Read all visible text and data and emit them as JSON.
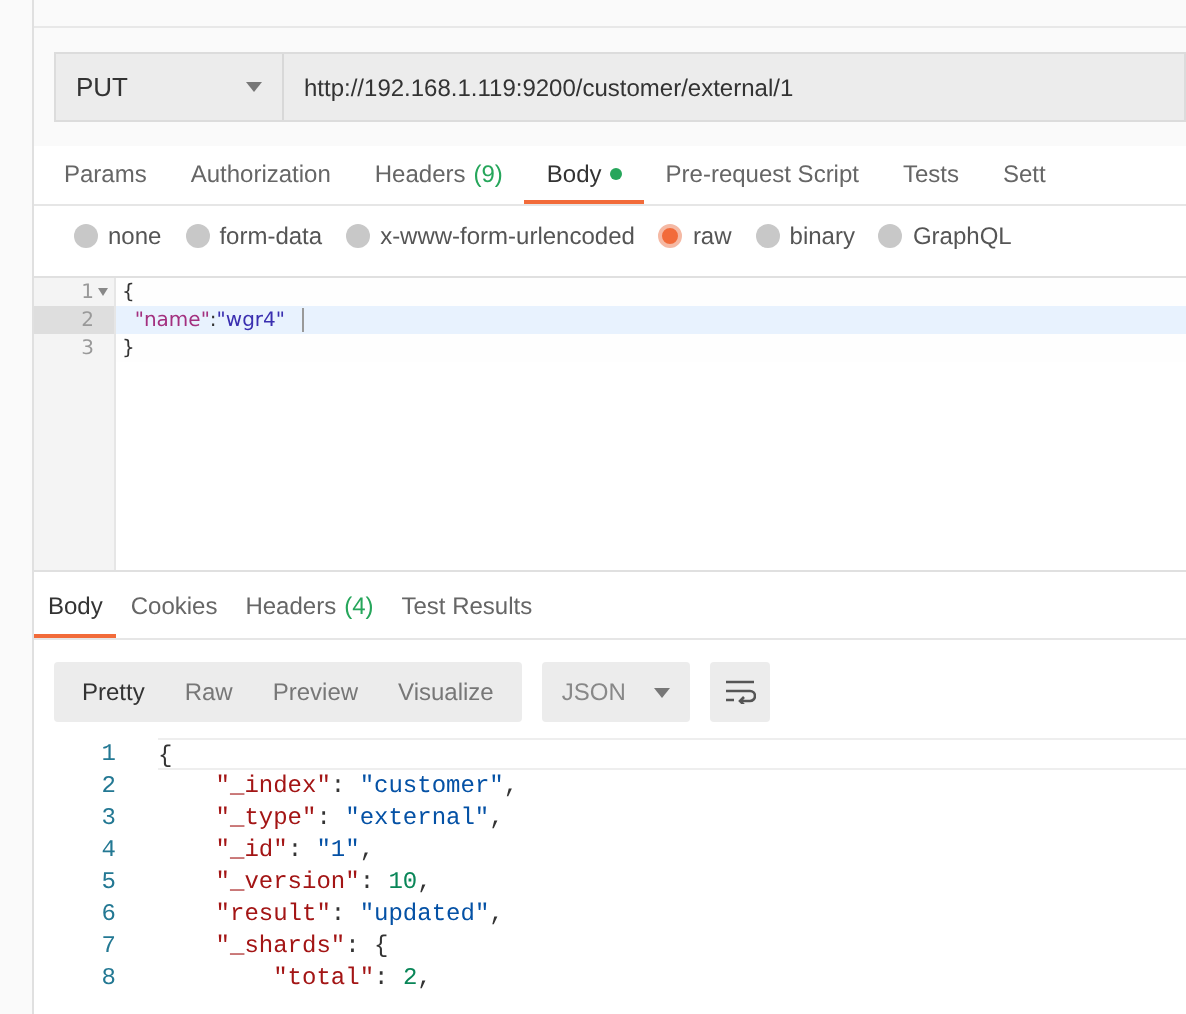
{
  "request": {
    "method": "PUT",
    "url": "http://192.168.1.119:9200/customer/external/1"
  },
  "request_tabs": [
    {
      "label": "Params",
      "selected": false
    },
    {
      "label": "Authorization",
      "selected": false
    },
    {
      "label": "Headers",
      "count": "(9)",
      "selected": false
    },
    {
      "label": "Body",
      "dot": true,
      "selected": true
    },
    {
      "label": "Pre-request Script",
      "selected": false
    },
    {
      "label": "Tests",
      "selected": false
    },
    {
      "label": "Sett",
      "selected": false
    }
  ],
  "body_types": [
    {
      "label": "none",
      "selected": false
    },
    {
      "label": "form-data",
      "selected": false
    },
    {
      "label": "x-www-form-urlencoded",
      "selected": false
    },
    {
      "label": "raw",
      "selected": true
    },
    {
      "label": "binary",
      "selected": false
    },
    {
      "label": "GraphQL",
      "selected": false
    }
  ],
  "request_editor": {
    "lines": [
      {
        "number": "1",
        "foldable": true,
        "active": false,
        "tokens": [
          {
            "kind": "punct",
            "text": "{"
          }
        ]
      },
      {
        "number": "2",
        "foldable": false,
        "active": true,
        "tokens": [
          {
            "kind": "key",
            "text": "  \"name\""
          },
          {
            "kind": "punct",
            "text": ":"
          },
          {
            "kind": "string",
            "text": "\"wgr4\""
          }
        ]
      },
      {
        "number": "3",
        "foldable": false,
        "active": false,
        "tokens": [
          {
            "kind": "punct",
            "text": "}"
          }
        ]
      }
    ]
  },
  "response_tabs": [
    {
      "label": "Body",
      "selected": true
    },
    {
      "label": "Cookies",
      "selected": false
    },
    {
      "label": "Headers",
      "count": "(4)",
      "selected": false
    },
    {
      "label": "Test Results",
      "selected": false
    }
  ],
  "view_modes": [
    {
      "label": "Pretty",
      "selected": true
    },
    {
      "label": "Raw",
      "selected": false
    },
    {
      "label": "Preview",
      "selected": false
    },
    {
      "label": "Visualize",
      "selected": false
    }
  ],
  "format": "JSON",
  "response_editor": {
    "lines": [
      {
        "number": "1",
        "tokens": [
          {
            "kind": "punct",
            "text": "{"
          }
        ]
      },
      {
        "number": "2",
        "tokens": [
          {
            "kind": "key",
            "text": "    \"_index\""
          },
          {
            "kind": "punct",
            "text": ": "
          },
          {
            "kind": "string",
            "text": "\"customer\""
          },
          {
            "kind": "punct",
            "text": ","
          }
        ]
      },
      {
        "number": "3",
        "tokens": [
          {
            "kind": "key",
            "text": "    \"_type\""
          },
          {
            "kind": "punct",
            "text": ": "
          },
          {
            "kind": "string",
            "text": "\"external\""
          },
          {
            "kind": "punct",
            "text": ","
          }
        ]
      },
      {
        "number": "4",
        "tokens": [
          {
            "kind": "key",
            "text": "    \"_id\""
          },
          {
            "kind": "punct",
            "text": ": "
          },
          {
            "kind": "string",
            "text": "\"1\""
          },
          {
            "kind": "punct",
            "text": ","
          }
        ]
      },
      {
        "number": "5",
        "tokens": [
          {
            "kind": "key",
            "text": "    \"_version\""
          },
          {
            "kind": "punct",
            "text": ": "
          },
          {
            "kind": "number",
            "text": "10"
          },
          {
            "kind": "punct",
            "text": ","
          }
        ]
      },
      {
        "number": "6",
        "tokens": [
          {
            "kind": "key",
            "text": "    \"result\""
          },
          {
            "kind": "punct",
            "text": ": "
          },
          {
            "kind": "string",
            "text": "\"updated\""
          },
          {
            "kind": "punct",
            "text": ","
          }
        ]
      },
      {
        "number": "7",
        "tokens": [
          {
            "kind": "key",
            "text": "    \"_shards\""
          },
          {
            "kind": "punct",
            "text": ": {"
          }
        ]
      },
      {
        "number": "8",
        "tokens": [
          {
            "kind": "key",
            "text": "        \"total\""
          },
          {
            "kind": "punct",
            "text": ": "
          },
          {
            "kind": "number",
            "text": "2"
          },
          {
            "kind": "punct",
            "text": ","
          }
        ]
      }
    ]
  }
}
